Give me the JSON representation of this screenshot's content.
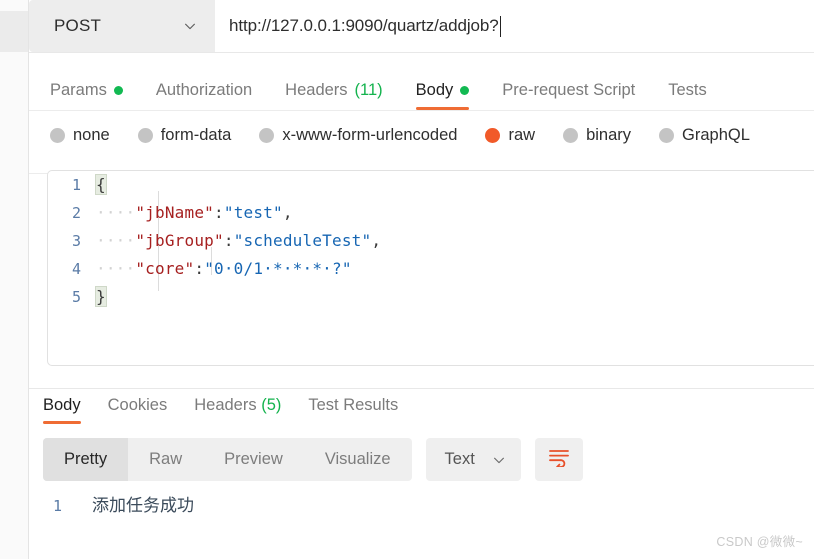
{
  "request": {
    "method": "POST",
    "url": "http://127.0.0.1:9090/quartz/addjob?",
    "tabs": [
      {
        "label": "Params",
        "badge": "",
        "badge_type": "dot",
        "active": false
      },
      {
        "label": "Authorization",
        "badge": "",
        "badge_type": "none",
        "active": false
      },
      {
        "label": "Headers",
        "badge": "(11)",
        "badge_type": "count",
        "active": false
      },
      {
        "label": "Body",
        "badge": "",
        "badge_type": "dot",
        "active": true
      },
      {
        "label": "Pre-request Script",
        "badge": "",
        "badge_type": "none",
        "active": false
      },
      {
        "label": "Tests",
        "badge": "",
        "badge_type": "none",
        "active": false
      }
    ],
    "body_types": [
      {
        "label": "none",
        "selected": false
      },
      {
        "label": "form-data",
        "selected": false
      },
      {
        "label": "x-www-form-urlencoded",
        "selected": false
      },
      {
        "label": "raw",
        "selected": true
      },
      {
        "label": "binary",
        "selected": false
      },
      {
        "label": "GraphQL",
        "selected": false
      }
    ],
    "editor": {
      "line_numbers": [
        "1",
        "2",
        "3",
        "4",
        "5"
      ],
      "lines": [
        {
          "indent": "",
          "brace": "{",
          "key": "",
          "value": "",
          "trail": ""
        },
        {
          "indent": "····",
          "brace": "",
          "key": "\"jbName\"",
          "value": "\"test\"",
          "trail": ","
        },
        {
          "indent": "····",
          "brace": "",
          "key": "\"jbGroup\"",
          "value": "\"scheduleTest\"",
          "trail": ","
        },
        {
          "indent": "····",
          "brace": "",
          "key": "\"core\"",
          "value": "\"0·0/1·*·*·*·?\"",
          "trail": ""
        },
        {
          "indent": "",
          "brace": "}",
          "key": "",
          "value": "",
          "trail": ""
        }
      ],
      "raw_json": "{\n    \"jbName\":\"test\",\n    \"jbGroup\":\"scheduleTest\",\n    \"core\":\"0 0/1 * * * ?\"\n}"
    }
  },
  "response": {
    "tabs": [
      {
        "label": "Body",
        "badge": "",
        "active": true
      },
      {
        "label": "Cookies",
        "badge": "",
        "active": false
      },
      {
        "label": "Headers",
        "badge": "(5)",
        "active": false
      },
      {
        "label": "Test Results",
        "badge": "",
        "active": false
      }
    ],
    "view_modes": [
      {
        "label": "Pretty",
        "active": true
      },
      {
        "label": "Raw",
        "active": false
      },
      {
        "label": "Preview",
        "active": false
      },
      {
        "label": "Visualize",
        "active": false
      }
    ],
    "format": "Text",
    "wrap_icon": "wrap-text-icon",
    "line_numbers": [
      "1"
    ],
    "body_lines": [
      "添加任务成功"
    ]
  },
  "watermark": "CSDN @微微~",
  "colors": {
    "accent": "#ef6c34",
    "radio_selected": "#f15a29",
    "dot_green": "#12b952",
    "count_green": "#14b34e",
    "json_key": "#a62020",
    "json_value": "#1766b3",
    "gutter": "#5a7ba6"
  }
}
